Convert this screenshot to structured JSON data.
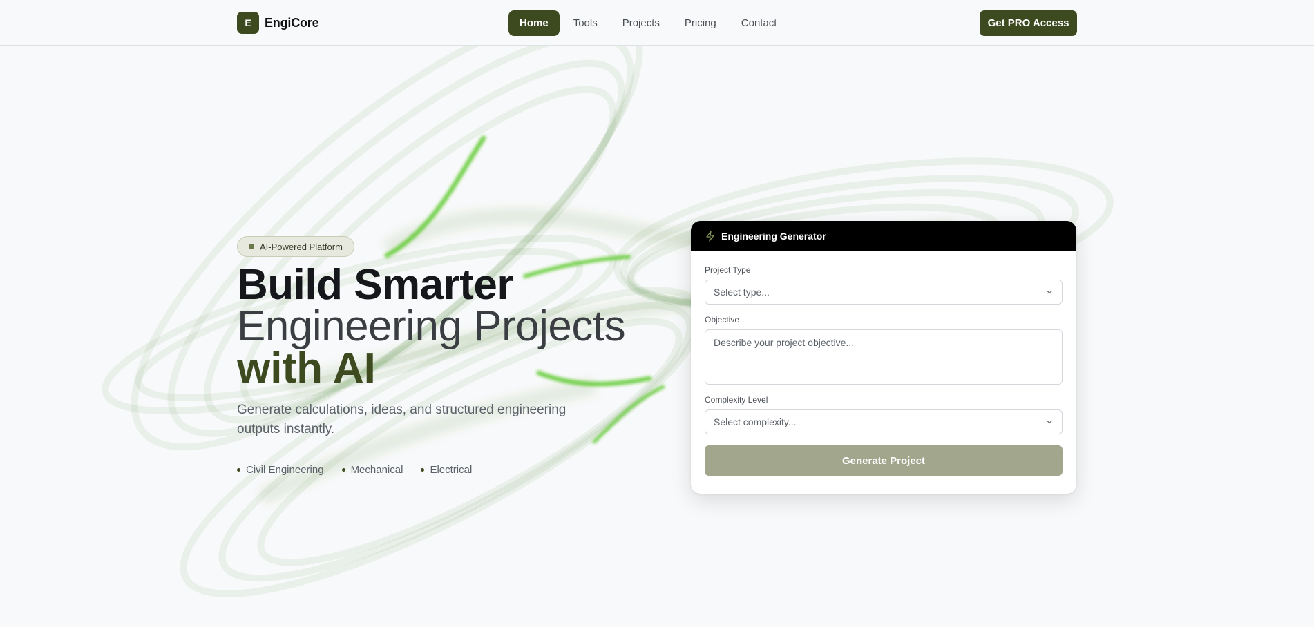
{
  "nav": {
    "logo_letter": "E",
    "brand": "EngiCore",
    "links": [
      {
        "label": "Home",
        "active": true
      },
      {
        "label": "Tools",
        "active": false
      },
      {
        "label": "Projects",
        "active": false
      },
      {
        "label": "Pricing",
        "active": false
      },
      {
        "label": "Contact",
        "active": false
      }
    ],
    "cta": "Get PRO Access"
  },
  "hero": {
    "badge": "AI-Powered Platform",
    "headline_line1": "Build Smarter",
    "headline_line2": "Engineering Projects",
    "headline_line3": "with AI",
    "subtitle": "Generate calculations, ideas, and structured engineering outputs instantly.",
    "tags": [
      "Civil Engineering",
      "Mechanical",
      "Electrical"
    ]
  },
  "generator": {
    "title": "Engineering Generator",
    "icon": "bolt-icon",
    "project_type_label": "Project Type",
    "project_type_placeholder": "Select type...",
    "objective_label": "Objective",
    "objective_placeholder": "Describe your project objective...",
    "complexity_label": "Complexity Level",
    "complexity_placeholder": "Select complexity...",
    "submit": "Generate Project"
  },
  "colors": {
    "brand_olive": "#3d4a1f",
    "card_header": "#000000",
    "button_disabled": "#a1a68c",
    "swirl_green": "#4fc61e"
  }
}
